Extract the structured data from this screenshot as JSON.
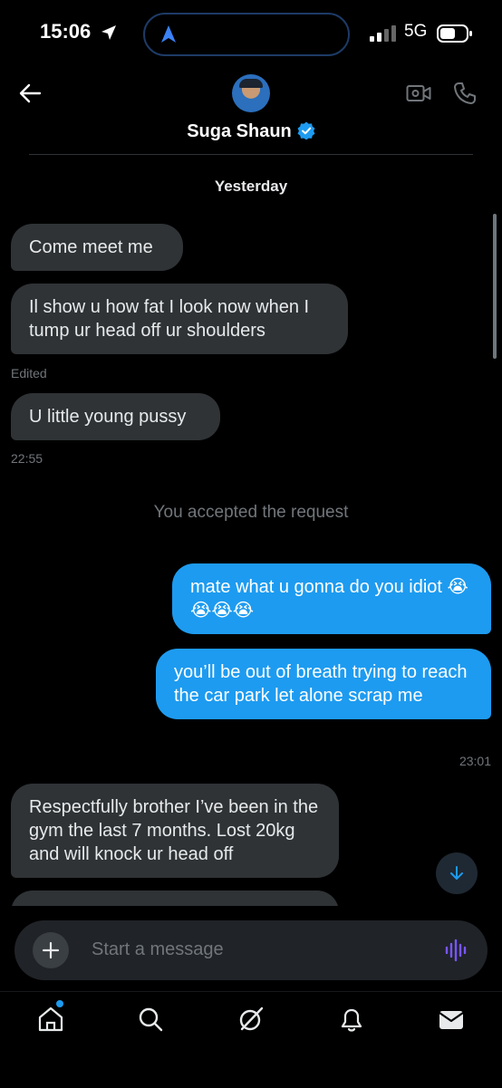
{
  "status_bar": {
    "time": "15:06",
    "network": "5G"
  },
  "header": {
    "contact_name": "Suga Shaun"
  },
  "thread": {
    "date_divider": "Yesterday",
    "messages": [
      {
        "side": "in",
        "text": "Come meet me"
      },
      {
        "side": "in",
        "text": "Il show u how fat I look now when I tump ur head off ur shoulders",
        "meta": "Edited"
      },
      {
        "side": "in",
        "text": "U little young pussy",
        "meta": "22:55"
      },
      {
        "side": "system",
        "text": "You accepted the request"
      },
      {
        "side": "out",
        "text": "mate what u gonna do you idiot 😭😭😭😭"
      },
      {
        "side": "out",
        "text": "you’ll be out of breath trying to reach the car park let alone scrap me",
        "meta": "23:01"
      },
      {
        "side": "in",
        "text": "Respectfully brother I’ve been in the gym the last 7 months. Lost 20kg and will knock ur head off"
      }
    ]
  },
  "composer": {
    "placeholder": "Start a message"
  },
  "tabs": [
    "home",
    "search",
    "grok",
    "notifications",
    "messages"
  ],
  "colors": {
    "accent": "#1d9bf0",
    "incoming_bubble": "#2f3336",
    "background": "#000000",
    "voice_icon": "#7856ff"
  }
}
